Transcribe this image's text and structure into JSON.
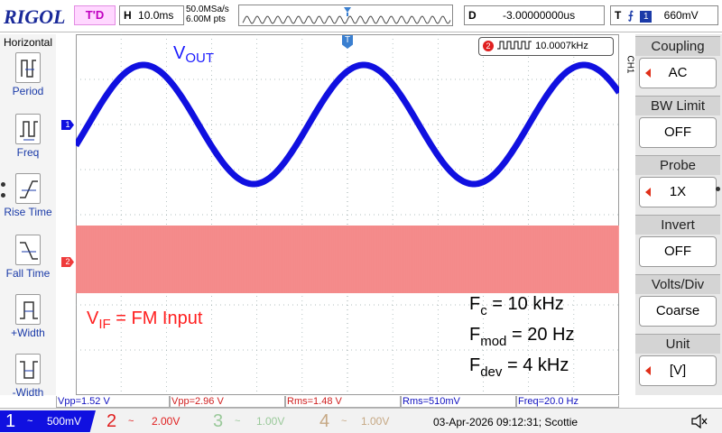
{
  "topbar": {
    "brand": "RIGOL",
    "trigger_state": "T'D",
    "timebase_label": "H",
    "timebase_value": "10.0ms",
    "sample_rate": "50.0MSa/s",
    "memory_depth": "6.00M pts",
    "delay_label": "D",
    "delay_value": "-3.00000000us",
    "trigger_label": "T",
    "trigger_source": "1",
    "trigger_level": "660mV"
  },
  "left_panel": {
    "title": "Horizontal",
    "items": [
      {
        "label": "Period",
        "icon": "period-icon"
      },
      {
        "label": "Freq",
        "icon": "freq-icon"
      },
      {
        "label": "Rise Time",
        "icon": "rise-time-icon"
      },
      {
        "label": "Fall Time",
        "icon": "fall-time-icon"
      },
      {
        "label": "+Width",
        "icon": "positive-width-icon"
      },
      {
        "label": "-Width",
        "icon": "negative-width-icon"
      }
    ]
  },
  "screen": {
    "ch1_marker": "1",
    "ch2_marker": "2",
    "trigger_marker": "T",
    "freq_counter": {
      "channel": "2",
      "value": "10.0007kHz"
    },
    "annotations": {
      "vout_main": "V",
      "vout_sub": "OUT",
      "vif_main": "V",
      "vif_sub": "IF",
      "vif_rest": " = FM Input",
      "fc_main": "F",
      "fc_sub": "c",
      "fc_rest": " = 10 kHz",
      "fmod_main": "F",
      "fmod_sub": "mod",
      "fmod_rest": " = 20 Hz",
      "fdev_main": "F",
      "fdev_sub": "dev",
      "fdev_rest": " = 4 kHz"
    },
    "colors": {
      "ch1": "#1010e0",
      "ch2": "#f06060",
      "grid": "#9aa"
    }
  },
  "right_panel": {
    "channel_tag": "CH1",
    "items": [
      {
        "title": "Coupling",
        "value": "AC"
      },
      {
        "title": "BW Limit",
        "value": "OFF"
      },
      {
        "title": "Probe",
        "value": "1X"
      },
      {
        "title": "Invert",
        "value": "OFF"
      },
      {
        "title": "Volts/Div",
        "value": "Coarse"
      },
      {
        "title": "Unit",
        "value": "[V]"
      }
    ]
  },
  "measurements": [
    {
      "text": "Vpp=1.52 V",
      "color": "#1010c0"
    },
    {
      "text": "Vpp=2.96 V",
      "color": "#d02020"
    },
    {
      "text": "Rms=1.48 V",
      "color": "#d02020"
    },
    {
      "text": "Rms=510mV",
      "color": "#1010c0"
    },
    {
      "text": "Freq=20.0 Hz",
      "color": "#1010c0"
    }
  ],
  "bottom": {
    "ch1": {
      "num": "1",
      "coupling": "~",
      "scale": "500mV"
    },
    "ch2": {
      "num": "2",
      "coupling": "~",
      "scale": "2.00V"
    },
    "ch3": {
      "num": "3",
      "coupling": "~",
      "scale": "1.00V"
    },
    "ch4": {
      "num": "4",
      "coupling": "~",
      "scale": "1.00V"
    },
    "datetime": "03-Apr-2026 09:12:31; Scottie"
  }
}
